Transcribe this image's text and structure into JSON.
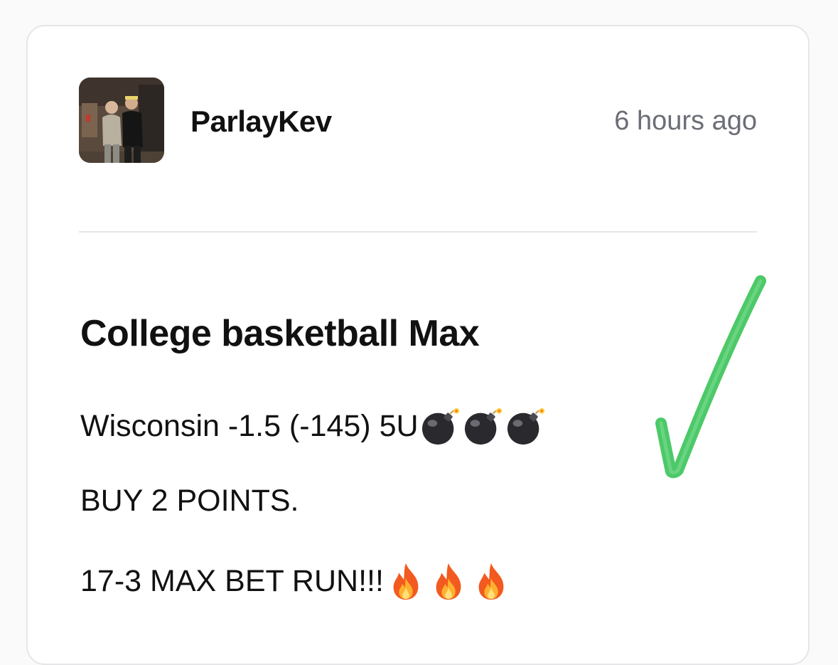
{
  "post": {
    "author": "ParlayKev",
    "timestamp": "6 hours ago",
    "title": "College basketball Max",
    "lines": [
      {
        "text": "Wisconsin -1.5 (-145) 5U",
        "emoji": "bomb-icon",
        "emoji_count": 3
      },
      {
        "text": "BUY 2 POINTS."
      },
      {
        "text": "17-3 MAX BET RUN!!!",
        "emoji": "fire-icon",
        "emoji_count": 3
      }
    ]
  },
  "overlay": {
    "checkmark_color": "#4cc968"
  }
}
